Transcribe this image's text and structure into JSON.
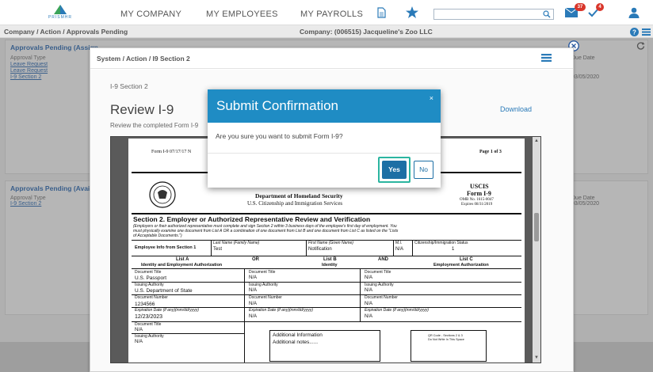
{
  "nav": {
    "logo_text": "PRISMHR",
    "links": [
      "MY COMPANY",
      "MY EMPLOYEES",
      "MY PAYROLLS"
    ],
    "mail_badge": "37",
    "check_badge": "4",
    "search_value": ""
  },
  "breadcrumb": "Company / Action / Approvals Pending",
  "company": "Company: (006515) Jacqueline's Zoo LLC",
  "panel_top": {
    "title": "Approvals Pending (Assign",
    "type_header": "Approval Type",
    "items": [
      "Leave Request",
      "Leave Request",
      "I-9 Section 2"
    ],
    "due_header": "Due Date",
    "due_value": "03/05/2020"
  },
  "panel_bottom": {
    "title": "Approvals Pending (Availal",
    "type_header": "Approval Type",
    "items": [
      "I-9 Section 2"
    ],
    "due_header": "Due Date",
    "due_value": "03/05/2020"
  },
  "window": {
    "title": "System / Action / I9 Section 2",
    "section_label": "I-9 Section 2",
    "review_title": "Review I-9",
    "review_sub": "Review the completed Form I-9",
    "download": "Download"
  },
  "document": {
    "form_id": "Form I-9 07/17/17 N",
    "page": "Page 1 of 3",
    "dept": "Department of Homeland Security",
    "agency": "U.S. Citizenship and Immigration Services",
    "uscis": "USCIS",
    "form": "Form I-9",
    "omb": "OMB No. 1615-0047",
    "expires": "Expires 08/31/2019",
    "section_title": "Section 2. Employer or Authorized Representative Review and Verification",
    "section_text_1": "(Employers or their authorized representative must complete and sign Section 2 within 3 business days of the employee's first day of employment. You",
    "section_text_2": "must physically examine one document from List A OR a combination of one document from List B and one document from List C as listed on the \"Lists",
    "section_text_3": "of Acceptable Documents.\")",
    "emp_info_label": "Employee Info from Section 1",
    "last_name_label": "Last Name (Family Name)",
    "last_name": "Test",
    "first_name_label": "First Name (Given Name)",
    "first_name": "Notification",
    "mi_label": "M.I.",
    "mi": "N/A",
    "status_label": "Citizenship/Immigration Status",
    "status": "1",
    "list_a": "List A",
    "list_a_sub": "Identity and Employment Authorization",
    "or": "OR",
    "list_b": "List B",
    "list_b_sub": "Identity",
    "and": "AND",
    "list_c": "List C",
    "list_c_sub": "Employment Authorization",
    "doc_title_label": "Document Title",
    "issuing_label": "Issuing Authority",
    "doc_number_label": "Document Number",
    "exp_label": "Expiration Date (if any)(mm/dd/yyyy)",
    "a_title": "U.S. Passport",
    "a_issuing": "U.S. Department of State",
    "a_number": "1234566",
    "a_exp": "12/23/2023",
    "na": "N/A",
    "additional_info": "Additional Information",
    "additional_notes": "Additional notes......",
    "qr_text_1": "QR Code - Sections 2 & 3",
    "qr_text_2": "Do Not Write In This Space"
  },
  "modal": {
    "title": "Submit Confirmation",
    "close": "×",
    "message": "Are you sure you want to submit Form I-9?",
    "yes": "Yes",
    "no": "No"
  }
}
